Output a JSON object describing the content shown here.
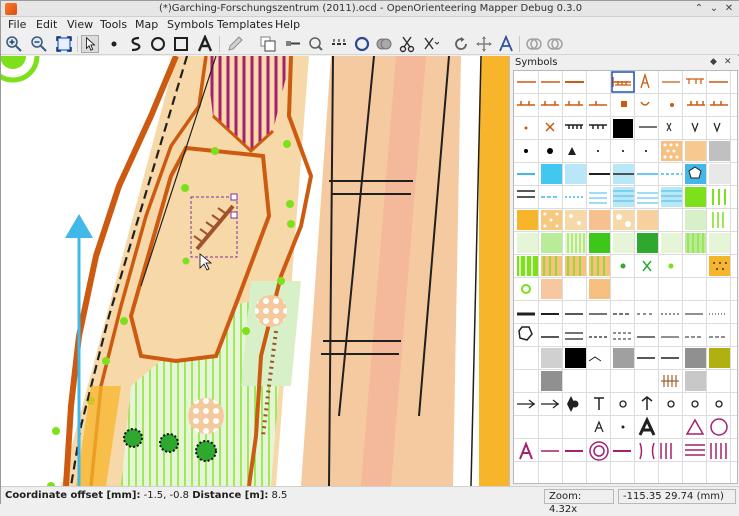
{
  "window": {
    "title": "(*)Garching-Forschungszentrum (2011).ocd - OpenOrienteering Mapper Debug 0.3.0",
    "minimize_glyph": "⌃",
    "maximize_glyph": "⌄",
    "close_glyph": "✕"
  },
  "menu": [
    {
      "label": "File"
    },
    {
      "label": "Edit"
    },
    {
      "label": "View"
    },
    {
      "label": "Tools"
    },
    {
      "label": "Map"
    },
    {
      "label": "Symbols"
    },
    {
      "label": "Templates"
    },
    {
      "label": "Help"
    }
  ],
  "toolbar": {
    "icons": [
      "zoom-in-icon",
      "zoom-out-icon",
      "fit-view-icon",
      "edit-select-icon",
      "draw-point-icon",
      "draw-path-icon",
      "draw-circle-icon",
      "draw-rectangle-icon",
      "draw-text-icon",
      "pencil-icon",
      "duplicate-icon",
      "switch-symbol-icon",
      "fill-border-icon",
      "switch-dashes-icon",
      "connect-paths-icon",
      "boolean-union-icon",
      "cut-icon",
      "cut-hole-icon",
      "rotate-icon",
      "measure-icon",
      "rotate-pattern-icon",
      "boolean-intersection-icon",
      "boolean-difference-icon"
    ]
  },
  "symbols_dock": {
    "title": "Symbols",
    "float_glyph": "◆",
    "close_glyph": "✕"
  },
  "statusbar": {
    "coordinate_label": "Coordinate offset [mm]:",
    "coordinate_value": "-1.5, -0.8",
    "distance_label": "Distance [m]:",
    "distance_value": "8.5",
    "zoom": "Zoom: 4.32x",
    "cursor_position": "-115.35 29.74 (mm)"
  },
  "colors": {
    "map_orange": "#cc5a10",
    "map_light_orange": "#f7d8a8",
    "map_tan": "#f6caa0",
    "map_green": "#7ce11a",
    "map_dark_green": "#2ea82e",
    "map_magenta": "#a4216f",
    "map_cyan": "#42b8e8",
    "map_yellow": "#f7b52b",
    "selection_purple": "#8030a0"
  }
}
